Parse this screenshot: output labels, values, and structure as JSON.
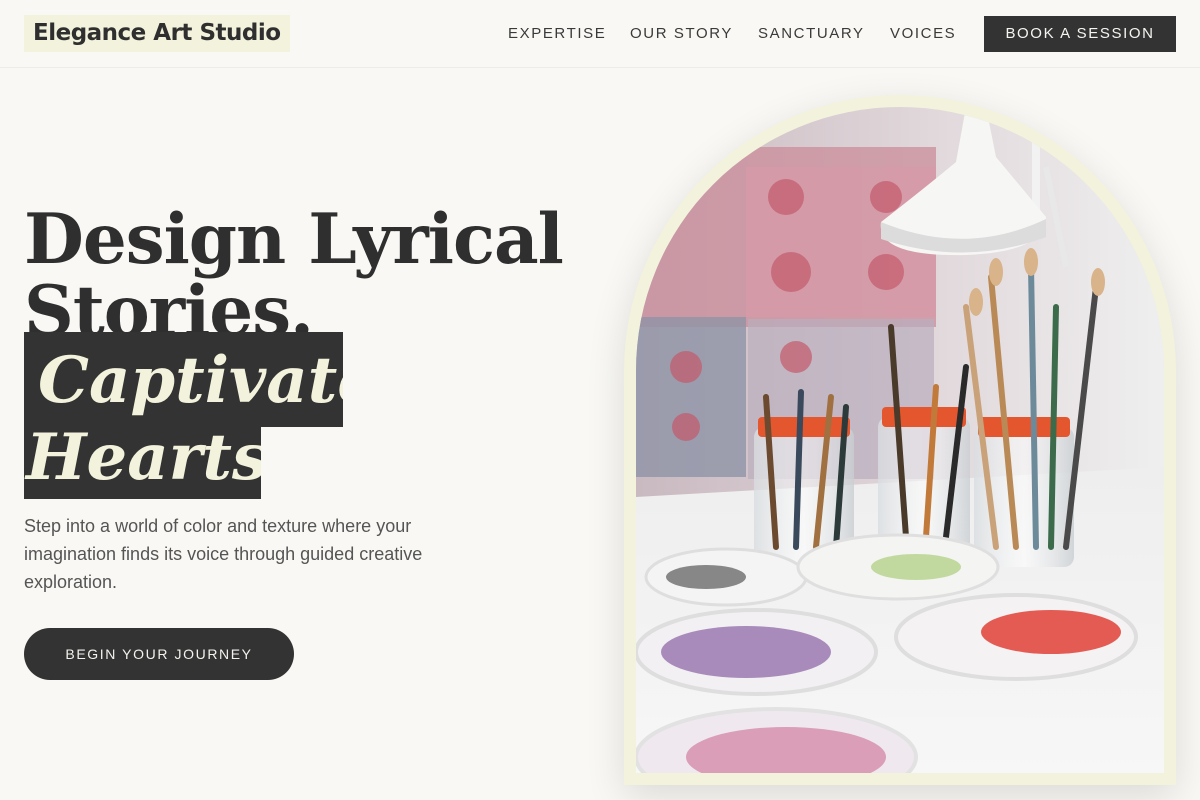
{
  "brand": {
    "name": "Elegance Art Studio"
  },
  "nav": {
    "links": [
      "EXPERTISE",
      "OUR STORY",
      "SANCTUARY",
      "VOICES"
    ],
    "cta_label": "BOOK A SESSION"
  },
  "hero": {
    "headline_line1": "Design Lyrical",
    "headline_line2": "Stories.",
    "highlight_line1": "Captivate",
    "highlight_line2": "Hearts.",
    "body": "Step into a world of color and texture where your imagination finds its voice through guided creative exploration.",
    "button_label": "BEGIN YOUR JOURNEY"
  },
  "colors": {
    "background": "#f9f8f4",
    "dark": "#333333",
    "cream_accent": "#f3f2dc",
    "text_muted": "#555555"
  },
  "icons": {
    "hero_image": "art-studio-brushes-photo"
  }
}
